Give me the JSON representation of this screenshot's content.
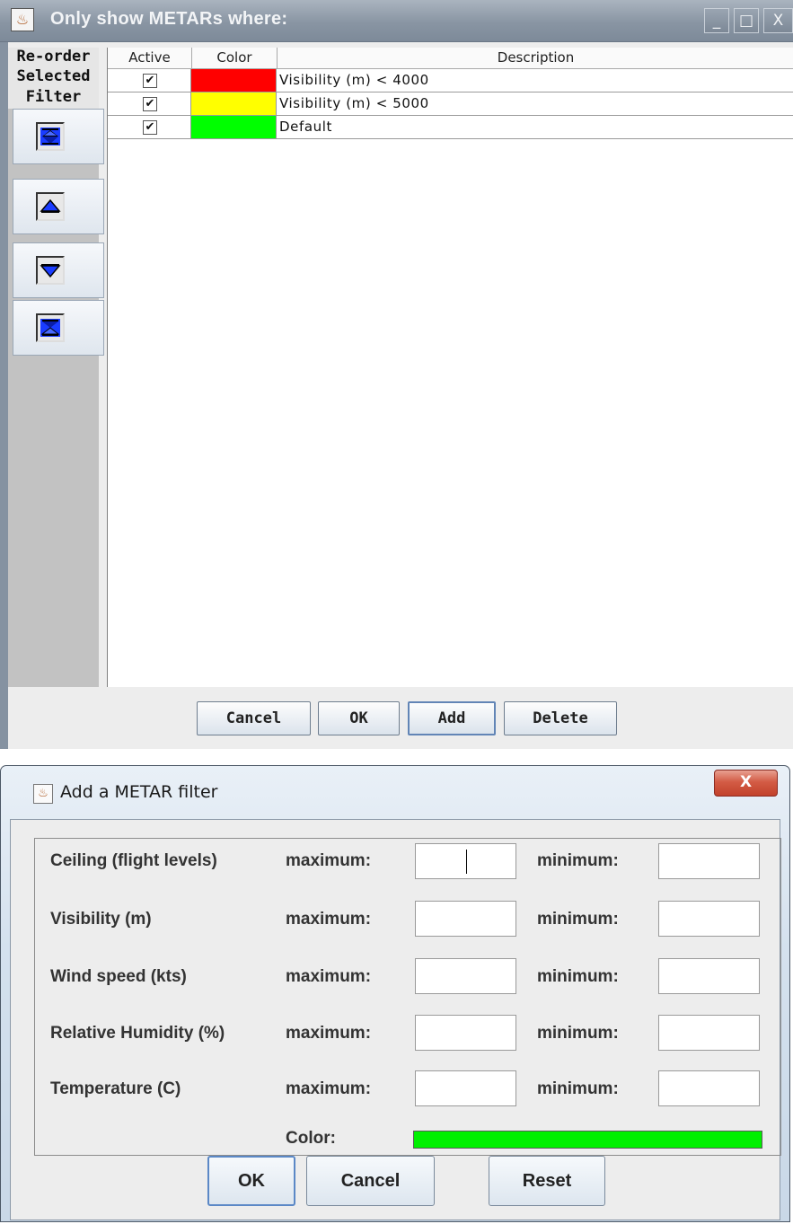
{
  "filter_window": {
    "title": "Only show METARs where:",
    "controls": {
      "minimize": "_",
      "maximize": "□",
      "close": "X"
    },
    "reorder_label": [
      "Re-order",
      "Selected",
      "Filter"
    ],
    "reorder_buttons": [
      "move-to-top",
      "move-up",
      "move-down",
      "move-to-bottom"
    ],
    "table": {
      "columns": [
        "Active",
        "Color",
        "Description"
      ],
      "rows": [
        {
          "active": true,
          "color": "#ff0000",
          "description": "Visibility (m) < 4000"
        },
        {
          "active": true,
          "color": "#ffff00",
          "description": "Visibility (m) < 5000"
        },
        {
          "active": true,
          "color": "#00ff00",
          "description": "Default"
        }
      ]
    },
    "buttons": {
      "cancel": "Cancel",
      "ok": "OK",
      "add": "Add",
      "delete": "Delete"
    }
  },
  "add_filter_dialog": {
    "title": "Add a METAR filter",
    "close": "X",
    "max_label": "maximum:",
    "min_label": "minimum:",
    "fields": [
      {
        "label": "Ceiling (flight levels)",
        "max": "",
        "min": ""
      },
      {
        "label": "Visibility (m)",
        "max": "",
        "min": ""
      },
      {
        "label": "Wind speed (kts)",
        "max": "",
        "min": ""
      },
      {
        "label": "Relative Humidity (%)",
        "max": "",
        "min": ""
      },
      {
        "label": "Temperature (C)",
        "max": "",
        "min": ""
      }
    ],
    "color_label": "Color:",
    "color_value": "#00f000",
    "buttons": {
      "ok": "OK",
      "cancel": "Cancel",
      "reset": "Reset"
    }
  }
}
